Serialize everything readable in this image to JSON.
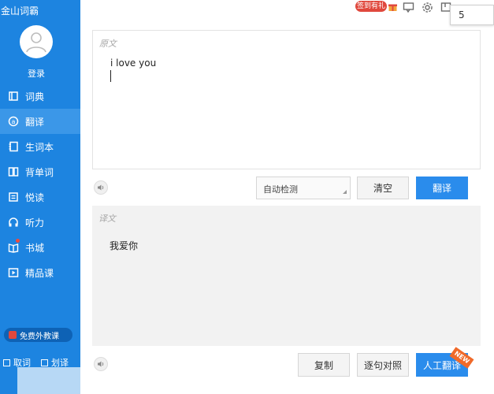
{
  "app": {
    "title": "金山词霸"
  },
  "user": {
    "login_label": "登录"
  },
  "sidebar": {
    "items": [
      {
        "label": "词典",
        "icon": "book-icon",
        "active": false
      },
      {
        "label": "翻译",
        "icon": "translate-icon",
        "active": true
      },
      {
        "label": "生词本",
        "icon": "notebook-icon",
        "active": false
      },
      {
        "label": "背单词",
        "icon": "flashcard-icon",
        "active": false
      },
      {
        "label": "悦读",
        "icon": "reading-icon",
        "active": false
      },
      {
        "label": "听力",
        "icon": "headphones-icon",
        "active": false
      },
      {
        "label": "书城",
        "icon": "bookstore-icon",
        "active": false
      },
      {
        "label": "精品课",
        "icon": "video-course-icon",
        "active": false
      }
    ],
    "promo_label": "免费外教课",
    "bottom_checks": [
      {
        "label": "取词",
        "checked": false
      },
      {
        "label": "划译",
        "checked": false
      }
    ]
  },
  "topbar": {
    "signin_badge": "签到有礼",
    "popup_value": "5"
  },
  "source": {
    "label": "原文",
    "text": "i love you"
  },
  "controls": {
    "language_select": "自动检测",
    "clear_label": "清空",
    "translate_label": "翻译"
  },
  "result": {
    "label": "译文",
    "text": "我爱你"
  },
  "result_actions": {
    "copy_label": "复制",
    "compare_label": "逐句对照",
    "human_translate_label": "人工翻译",
    "new_badge": "NEW"
  },
  "colors": {
    "sidebar": "#1d84e0",
    "sidebar_active": "#3b97e8",
    "primary_button": "#2a8cec",
    "badge_red": "#e0483d"
  }
}
